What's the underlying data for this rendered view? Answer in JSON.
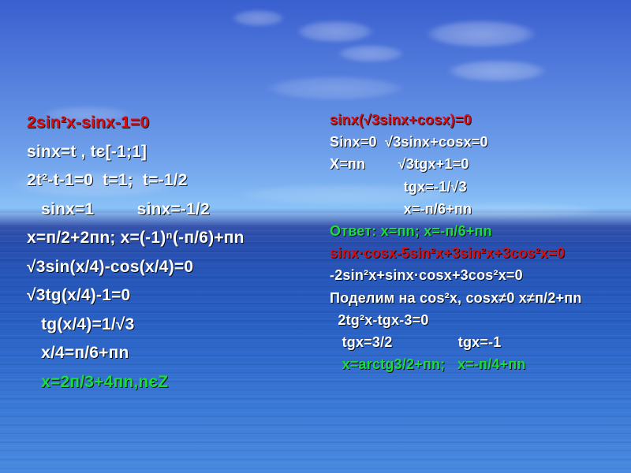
{
  "left": {
    "l1": "2sin²x-sinx-1=0",
    "l2": "sinx=t , tє[-1;1]",
    "l3": "2t²-t-1=0  t=1;  t=-1/2",
    "l4": "   sinx=1         sinx=-1/2",
    "l5": "x=п/2+2пn; x=(-1)ⁿ(-п/6)+пn",
    "l6": "√3sin(x/4)-cos(x/4)=0",
    "l7": "√3tg(x/4)-1=0",
    "l8": "   tg(x/4)=1/√3",
    "l9": "   x/4=п/6+пn",
    "l10": "   x=2п/3+4пn,nєZ"
  },
  "right": {
    "r1": "sinx(√3sinx+cosx)=0",
    "r2": "Sinx=0  √3sinx+cosx=0",
    "r3": "X=пn        √3tgx+1=0",
    "r4": "                  tgx=-1/√3",
    "r5": "                  x=-п/6+пn",
    "r6": "Ответ: x=пn; x=-п/6+пn",
    "r7": "sinx·cosx-5sin²x+3sin²x+3cos²x=0",
    "r8": "-2sin²x+sinx·cosx+3cos²x=0",
    "r9": "Поделим на cos²x, cosx≠0 x≠п/2+пn",
    "r10": "  2tg²x-tgx-3=0",
    "r11": "   tgx=3/2                tgx=-1",
    "r12": "   x=arctg3/2+пn;   x=-п/4+пn"
  },
  "colors": {
    "red": "#d90d0d",
    "green": "#1bdc3a",
    "white": "#ffffff"
  }
}
